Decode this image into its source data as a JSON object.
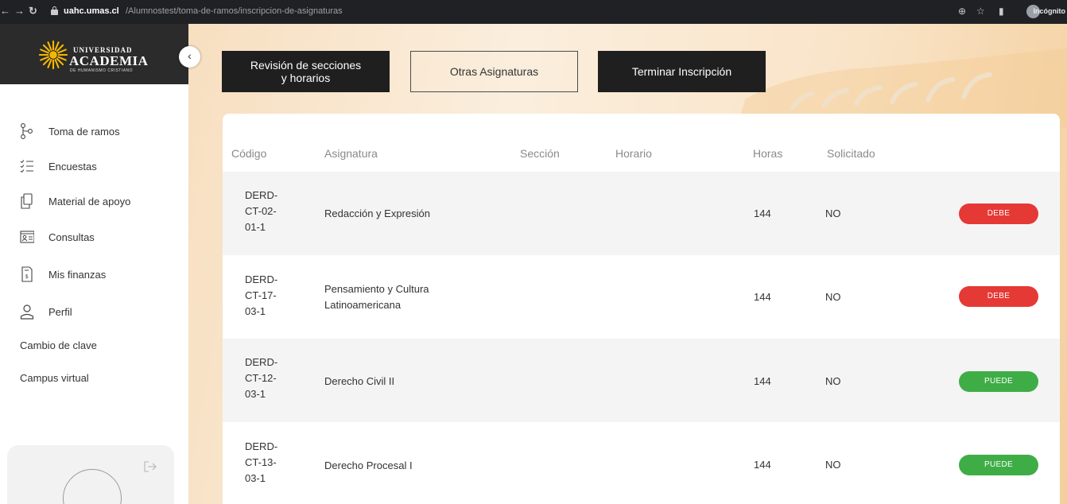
{
  "browser": {
    "url_host": "uahc.umas.cl",
    "url_path": "/Alumnostest/toma-de-ramos/inscripcion-de-asignaturas",
    "incognito_label": "Incógnito"
  },
  "brand": {
    "line1": "UNIVERSIDAD",
    "line2": "ACADEMIA",
    "line3": "DE HUMANISMO CRISTIANO",
    "sun_color": "#f5b800"
  },
  "sidebar": {
    "items": [
      {
        "label": "Toma de ramos",
        "icon": "route-icon"
      },
      {
        "label": "Encuestas",
        "icon": "checklist-icon"
      },
      {
        "label": "Material de apoyo",
        "icon": "copy-icon"
      },
      {
        "label": "Consultas",
        "icon": "id-card-icon"
      },
      {
        "label": "Mis finanzas",
        "icon": "invoice-icon"
      },
      {
        "label": "Perfil",
        "icon": "user-icon"
      }
    ],
    "links": [
      {
        "label": "Cambio de clave"
      },
      {
        "label": "Campus virtual"
      }
    ]
  },
  "toolbar": {
    "review_label_line1": "Revisión de secciones",
    "review_label_line2": "y horarios",
    "other_label": "Otras Asignaturas",
    "finish_label": "Terminar Inscripción"
  },
  "table": {
    "headers": {
      "code": "Código",
      "subject": "Asignatura",
      "section": "Sección",
      "schedule": "Horario",
      "hours": "Horas",
      "requested": "Solicitado"
    },
    "rows": [
      {
        "code_lines": [
          "DERD-",
          "CT-02-",
          "01-1"
        ],
        "subject_lines": [
          "Redacción y Expresión"
        ],
        "hours": "144",
        "requested": "NO",
        "status": "DEBE",
        "status_color": "#e53935"
      },
      {
        "code_lines": [
          "DERD-",
          "CT-17-",
          "03-1"
        ],
        "subject_lines": [
          "Pensamiento y Cultura",
          "Latinoamericana"
        ],
        "hours": "144",
        "requested": "NO",
        "status": "DEBE",
        "status_color": "#e53935"
      },
      {
        "code_lines": [
          "DERD-",
          "CT-12-",
          "03-1"
        ],
        "subject_lines": [
          "Derecho Civil II"
        ],
        "hours": "144",
        "requested": "NO",
        "status": "PUEDE",
        "status_color": "#3fad46"
      },
      {
        "code_lines": [
          "DERD-",
          "CT-13-",
          "03-1"
        ],
        "subject_lines": [
          "Derecho Procesal I"
        ],
        "hours": "144",
        "requested": "NO",
        "status": "PUEDE",
        "status_color": "#3fad46"
      }
    ]
  }
}
